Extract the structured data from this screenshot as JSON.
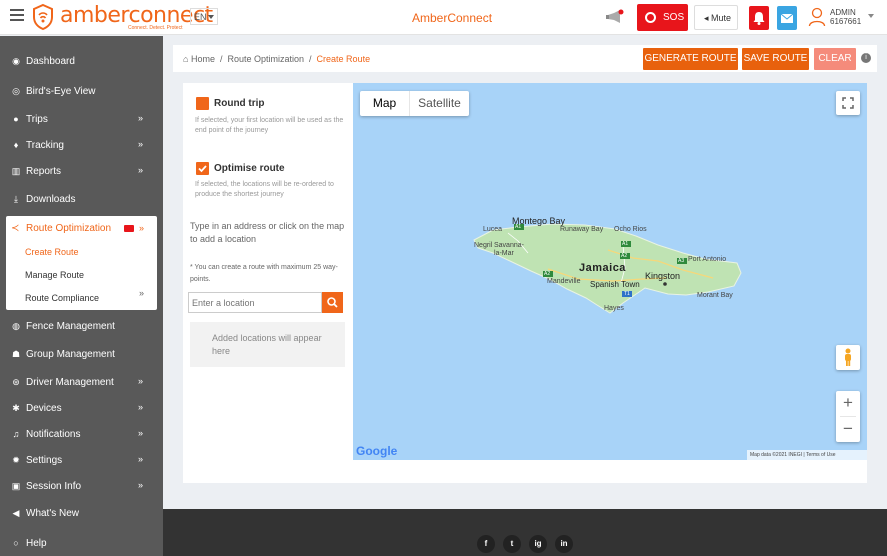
{
  "header": {
    "brand": "amberconnect",
    "tagline": "Connect. Detect. Protect",
    "language": "EN",
    "app_title": "AmberConnect",
    "sos_label": "SOS",
    "mute_label": "Mute",
    "user_role": "ADMIN",
    "user_id": "6167661"
  },
  "sidebar": {
    "items": [
      {
        "label": "Dashboard",
        "icon": "dashboard-icon"
      },
      {
        "label": "Bird's-Eye View",
        "icon": "eye-icon"
      },
      {
        "label": "Trips",
        "icon": "map-marker-icon"
      },
      {
        "label": "Tracking",
        "icon": "location-pin-icon"
      },
      {
        "label": "Reports",
        "icon": "bar-chart-icon"
      },
      {
        "label": "Downloads",
        "icon": "download-icon"
      },
      {
        "label": "Route Optimization",
        "icon": "share-icon"
      },
      {
        "label": "Fence Management",
        "icon": "globe-icon"
      },
      {
        "label": "Group Management",
        "icon": "group-icon"
      },
      {
        "label": "Driver Management",
        "icon": "steering-icon"
      },
      {
        "label": "Devices",
        "icon": "gears-icon"
      },
      {
        "label": "Notifications",
        "icon": "bell-icon"
      },
      {
        "label": "Settings",
        "icon": "gear-icon"
      },
      {
        "label": "Session Info",
        "icon": "lock-icon"
      },
      {
        "label": "What's New",
        "icon": "bullhorn-icon"
      },
      {
        "label": "Help",
        "icon": "chat-icon"
      }
    ],
    "route_sub": [
      "Create Route",
      "Manage Route",
      "Route Compliance"
    ]
  },
  "breadcrumb": {
    "home": "Home",
    "section": "Route Optimization",
    "current": "Create Route"
  },
  "actions": {
    "generate": "GENERATE ROUTE",
    "save": "SAVE ROUTE",
    "clear": "CLEAR"
  },
  "options": {
    "round_trip_label": "Round trip",
    "round_trip_hint": "If selected, your first location will be used as the end point of the journey",
    "optimise_label": "Optimise route",
    "optimise_hint": "If selected, the locations will be re-ordered to produce the shortest journey",
    "type_address": "Type in an address or click on the map to add a location",
    "max_note": "* You can create a route with maximum 25 way-points.",
    "location_placeholder": "Enter a location",
    "added_placeholder": "Added locations will appear here"
  },
  "map": {
    "tab_map": "Map",
    "tab_satellite": "Satellite",
    "country": "Jamaica",
    "capital": "Kingston",
    "places": {
      "montego_bay": "Montego Bay",
      "lucea": "Lucea",
      "runaway_bay": "Runaway Bay",
      "ocho_rios": "Ocho Rios",
      "negril": "Negril",
      "savanna": "Savanna-la-Mar",
      "port_antonio": "Port Antonio",
      "mandeville": "Mandeville",
      "spanish_town": "Spanish Town",
      "hayes": "Hayes",
      "morant_bay": "Morant Bay"
    },
    "roads": {
      "a1a": "A1",
      "a1b": "A1",
      "a2a": "A2",
      "a2b": "A2",
      "a3": "A3",
      "t1": "T1"
    },
    "google": "Google",
    "attribution": "Map data ©2021 INEGI | Terms of Use"
  },
  "footer": {
    "social": [
      "f",
      "t",
      "ig",
      "in"
    ]
  }
}
